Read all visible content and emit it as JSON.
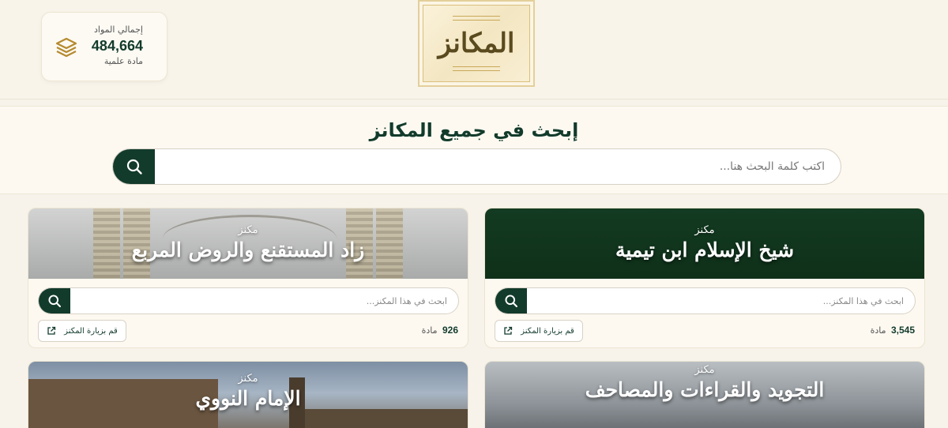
{
  "header": {
    "logo_text": "المكانز",
    "stats": {
      "label": "إجمالي المواد",
      "value": "484,664",
      "unit": "مادة علمية",
      "icon": "layers-icon"
    }
  },
  "search": {
    "title": "إبحث في جميع المكانز",
    "placeholder": "اكتب كلمة البحث هنا..."
  },
  "cards": [
    {
      "subtitle": "مكنز",
      "title": "شيخ الإسلام ابن تيمية",
      "search_placeholder": "ابحث في هذا المكنز...",
      "count": "3,545",
      "count_unit": "مادة",
      "visit_label": "قم بزيارة المكنز"
    },
    {
      "subtitle": "مكنز",
      "title": "زاد المستقنع والروض المربع",
      "search_placeholder": "ابحث في هذا المكنز...",
      "count": "926",
      "count_unit": "مادة",
      "visit_label": "قم بزيارة المكنز"
    },
    {
      "subtitle": "مكنز",
      "title": "التجويد والقراءات والمصاحف"
    },
    {
      "subtitle": "مكنز",
      "title": "الإمام النووي"
    }
  ],
  "colors": {
    "primary": "#123b2c",
    "background": "#f7f3ea",
    "gold": "#c9a85a"
  }
}
